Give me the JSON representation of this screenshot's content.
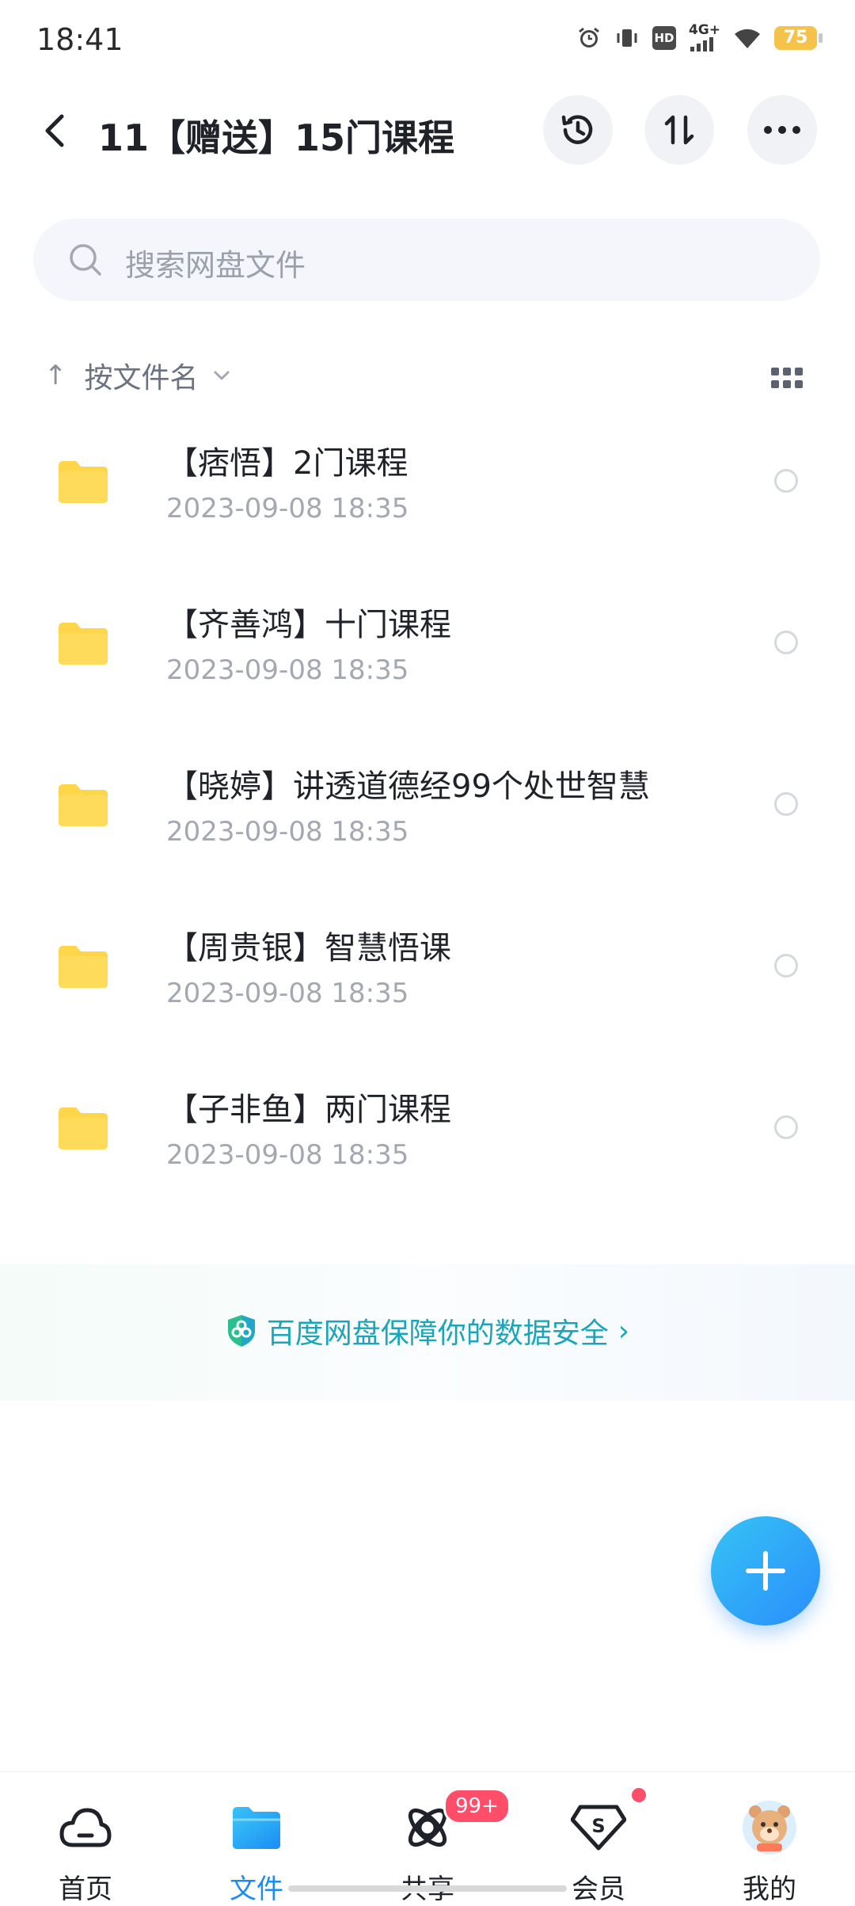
{
  "status_bar": {
    "time": "18:41",
    "icons": [
      "alarm-icon",
      "vibrate-icon",
      "hd-icon",
      "signal-4g-icon",
      "wifi-icon",
      "battery-icon"
    ],
    "hd": "HD",
    "network": "4G+",
    "battery": "75"
  },
  "header": {
    "title": "11【赠送】15门课程",
    "buttons": [
      "history-icon",
      "transfer-icon",
      "more-icon"
    ]
  },
  "search": {
    "placeholder": "搜索网盘文件"
  },
  "sort": {
    "arrow": "↑",
    "label": "按文件名"
  },
  "files": [
    {
      "name": "【痞悟】2门课程",
      "date": "2023-09-08  18:35"
    },
    {
      "name": "【齐善鸿】十门课程",
      "date": "2023-09-08  18:35"
    },
    {
      "name": "【晓婷】讲透道德经99个处世智慧",
      "date": "2023-09-08  18:35"
    },
    {
      "name": "【周贵银】智慧悟课",
      "date": "2023-09-08  18:35"
    },
    {
      "name": "【子非鱼】两门课程",
      "date": "2023-09-08  18:35"
    }
  ],
  "safety_banner": {
    "text": "百度网盘保障你的数据安全",
    "chevron": "›"
  },
  "bottom_nav": {
    "items": [
      {
        "label": "首页",
        "icon": "cloud-home-icon"
      },
      {
        "label": "文件",
        "icon": "folder-icon"
      },
      {
        "label": "共享",
        "icon": "share-orbit-icon"
      },
      {
        "label": "会员",
        "icon": "vip-diamond-icon"
      },
      {
        "label": "我的",
        "icon": "avatar"
      }
    ],
    "share_badge": "99+",
    "active_index": 1
  },
  "colors": {
    "accent": "#1b8cf5",
    "folder": "#ffd54a",
    "badge": "#ff4d6a",
    "safety": "#1aa6b8"
  }
}
